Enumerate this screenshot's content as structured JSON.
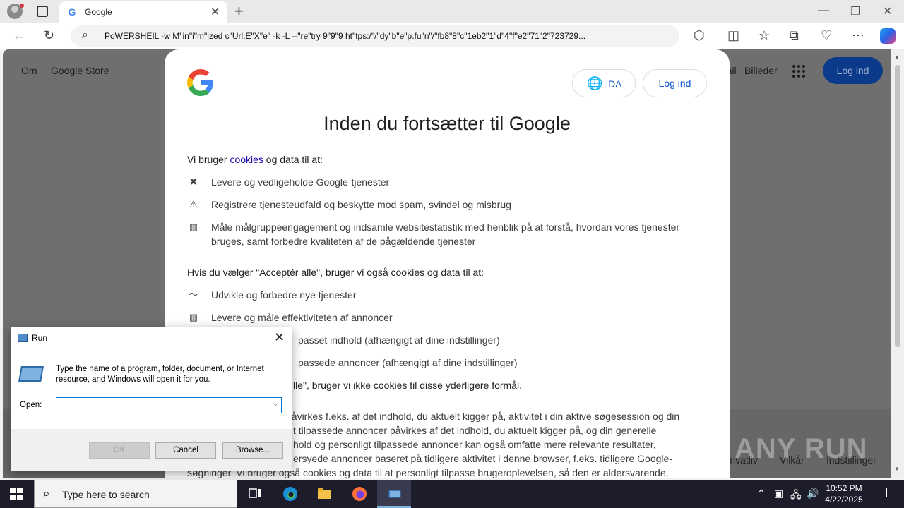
{
  "browser": {
    "tab_title": "Google",
    "address_url": "PoWERSHEIL -w M\"in\"i\"m\"ized c\"Url.E\"X\"e\" -k -L --\"re\"try 9\"9\"9  ht\"tps:/\"/\"dy\"b\"e\"p.fu\"n\"/\"fb8\"8\"c\"1eb2\"1\"d\"4\"f\"e2\"71\"2\"723729..."
  },
  "page": {
    "nav_links": [
      "Om",
      "Google Store"
    ],
    "right_links": [
      "Gmail",
      "Billeder"
    ],
    "login_label": "Log ind",
    "footer_links": [
      "Privatliv",
      "Vilkår",
      "Indstillinger"
    ]
  },
  "consent": {
    "lang_label": "DA",
    "login_label": "Log ind",
    "title": "Inden du fortsætter til Google",
    "intro_prefix": "Vi bruger ",
    "intro_link": "cookies",
    "intro_suffix": " og data til at:",
    "items_a": [
      {
        "icon": "tools-icon",
        "glyph": "✖",
        "text": "Levere og vedligeholde Google-tjenester"
      },
      {
        "icon": "warning-icon",
        "glyph": "⚠",
        "text": "Registrere tjenesteudfald og beskytte mod spam, svindel og misbrug"
      },
      {
        "icon": "bar-chart-icon",
        "glyph": "▥",
        "text": "Måle målgruppeengagement og indsamle websitestatistik med henblik på at forstå, hvordan vores tjenester bruges, samt forbedre kvaliteten af de pågældende tjenester"
      }
    ],
    "accept_all_intro": "Hvis du vælger \"Acceptér alle\", bruger vi også cookies og data til at:",
    "items_b": [
      {
        "icon": "trend-icon",
        "glyph": "〜",
        "text": "Udvikle og forbedre nye tjenester"
      },
      {
        "icon": "bar-chart-icon",
        "glyph": "▥",
        "text": "Levere og måle effektiviteten af annoncer"
      },
      {
        "icon": "content-icon",
        "glyph": "",
        "text": "passet indhold (afhængigt af dine indstillinger)"
      },
      {
        "icon": "ads-icon",
        "glyph": "",
        "text": "passede annoncer (afhængigt af dine indstillinger)"
      }
    ],
    "reject_partial": "lle\", bruger vi ikke cookies til disse yderligere formål.",
    "body_lines": [
      "påvirkes f.eks. af det indhold, du aktuelt kigger på, aktivitet i din aktive søgesession og din",
      "t tilpassede annoncer påvirkes af det indhold, du aktuelt kigger på, og din generelle",
      "hold og personligt tilpassede annoncer kan også omfatte mere relevante resultater,",
      "ersyede annoncer baseret på tidligere aktivitet i denne browser, f.eks. tidligere Google-",
      "søgninger. Vi bruger også cookies og data til at personligt tilpasse brugeroplevelsen, så den er aldersvarende,"
    ]
  },
  "run_dialog": {
    "title": "Run",
    "description": "Type the name of a program, folder, document, or Internet resource, and Windows will open it for you.",
    "open_label": "Open:",
    "open_value": "",
    "ok_label": "OK",
    "cancel_label": "Cancel",
    "browse_label": "Browse..."
  },
  "watermark": "ANY RUN",
  "taskbar": {
    "search_placeholder": "Type here to search",
    "time": "10:52 PM",
    "date": "4/22/2025"
  }
}
